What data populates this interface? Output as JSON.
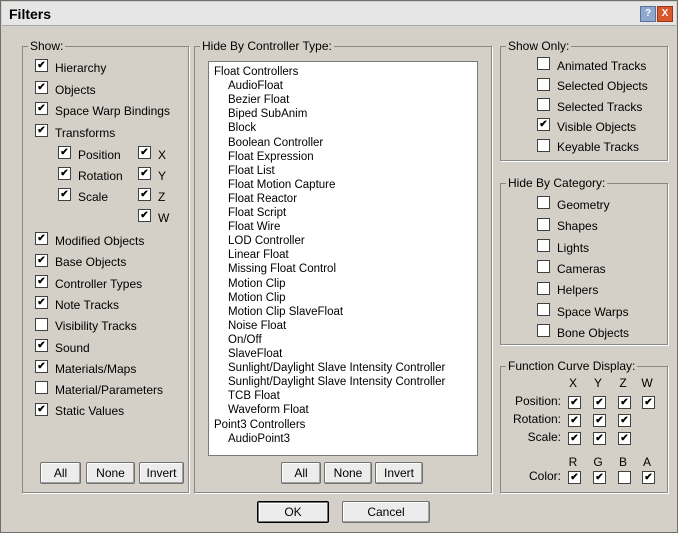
{
  "window": {
    "title": "Filters",
    "help_label": "?",
    "close_label": "X"
  },
  "show": {
    "label": "Show:",
    "items": [
      {
        "label": "Hierarchy",
        "checked": true
      },
      {
        "label": "Objects",
        "checked": true
      },
      {
        "label": "Space Warp Bindings",
        "checked": true
      },
      {
        "label": "Transforms",
        "checked": true
      }
    ],
    "transforms": [
      {
        "label": "Position",
        "checked": true
      },
      {
        "label": "Rotation",
        "checked": true
      },
      {
        "label": "Scale",
        "checked": true
      }
    ],
    "axes": [
      {
        "label": "X",
        "checked": true
      },
      {
        "label": "Y",
        "checked": true
      },
      {
        "label": "Z",
        "checked": true
      },
      {
        "label": "W",
        "checked": true
      }
    ],
    "items2": [
      {
        "label": "Modified Objects",
        "checked": true
      },
      {
        "label": "Base Objects",
        "checked": true
      },
      {
        "label": "Controller Types",
        "checked": true
      },
      {
        "label": "Note Tracks",
        "checked": true
      },
      {
        "label": "Visibility Tracks",
        "checked": false
      },
      {
        "label": "Sound",
        "checked": true
      },
      {
        "label": "Materials/Maps",
        "checked": true
      },
      {
        "label": "Material/Parameters",
        "checked": false
      },
      {
        "label": "Static Values",
        "checked": true
      }
    ],
    "buttons": {
      "all": "All",
      "none": "None",
      "invert": "Invert"
    }
  },
  "hide_controller": {
    "label": "Hide By Controller Type:",
    "items": [
      {
        "text": "Float Controllers",
        "sub": false
      },
      {
        "text": "AudioFloat",
        "sub": true
      },
      {
        "text": "Bezier Float",
        "sub": true
      },
      {
        "text": "Biped SubAnim",
        "sub": true
      },
      {
        "text": "Block",
        "sub": true
      },
      {
        "text": "Boolean Controller",
        "sub": true
      },
      {
        "text": "Float Expression",
        "sub": true
      },
      {
        "text": "Float List",
        "sub": true
      },
      {
        "text": "Float Motion Capture",
        "sub": true
      },
      {
        "text": "Float Reactor",
        "sub": true
      },
      {
        "text": "Float Script",
        "sub": true
      },
      {
        "text": "Float Wire",
        "sub": true
      },
      {
        "text": "LOD Controller",
        "sub": true
      },
      {
        "text": "Linear Float",
        "sub": true
      },
      {
        "text": "Missing Float Control",
        "sub": true
      },
      {
        "text": "Motion Clip",
        "sub": true
      },
      {
        "text": "Motion Clip",
        "sub": true
      },
      {
        "text": "Motion Clip SlaveFloat",
        "sub": true
      },
      {
        "text": "Noise Float",
        "sub": true
      },
      {
        "text": "On/Off",
        "sub": true
      },
      {
        "text": "SlaveFloat",
        "sub": true
      },
      {
        "text": "Sunlight/Daylight Slave Intensity Controller",
        "sub": true
      },
      {
        "text": "Sunlight/Daylight Slave Intensity Controller",
        "sub": true
      },
      {
        "text": "TCB Float",
        "sub": true
      },
      {
        "text": "Waveform Float",
        "sub": true
      },
      {
        "text": "Point3 Controllers",
        "sub": false
      },
      {
        "text": "AudioPoint3",
        "sub": true
      }
    ],
    "buttons": {
      "all": "All",
      "none": "None",
      "invert": "Invert"
    }
  },
  "show_only": {
    "label": "Show Only:",
    "items": [
      {
        "label": "Animated Tracks",
        "checked": false
      },
      {
        "label": "Selected Objects",
        "checked": false
      },
      {
        "label": "Selected Tracks",
        "checked": false
      },
      {
        "label": "Visible Objects",
        "checked": true
      },
      {
        "label": "Keyable Tracks",
        "checked": false
      }
    ]
  },
  "hide_category": {
    "label": "Hide By Category:",
    "items": [
      {
        "label": "Geometry",
        "checked": false
      },
      {
        "label": "Shapes",
        "checked": false
      },
      {
        "label": "Lights",
        "checked": false
      },
      {
        "label": "Cameras",
        "checked": false
      },
      {
        "label": "Helpers",
        "checked": false
      },
      {
        "label": "Space Warps",
        "checked": false
      },
      {
        "label": "Bone Objects",
        "checked": false
      }
    ]
  },
  "function_curve": {
    "label": "Function Curve Display:",
    "xyzw": [
      "X",
      "Y",
      "Z",
      "W"
    ],
    "rows": [
      {
        "label": "Position:",
        "checks": [
          true,
          true,
          true,
          true
        ]
      },
      {
        "label": "Rotation:",
        "checks": [
          true,
          true,
          true
        ]
      },
      {
        "label": "Scale:",
        "checks": [
          true,
          true,
          true
        ]
      }
    ],
    "rgba": [
      "R",
      "G",
      "B",
      "A"
    ],
    "color": {
      "label": "Color:",
      "checks": [
        true,
        true,
        false,
        true
      ]
    }
  },
  "footer": {
    "ok": "OK",
    "cancel": "Cancel"
  }
}
